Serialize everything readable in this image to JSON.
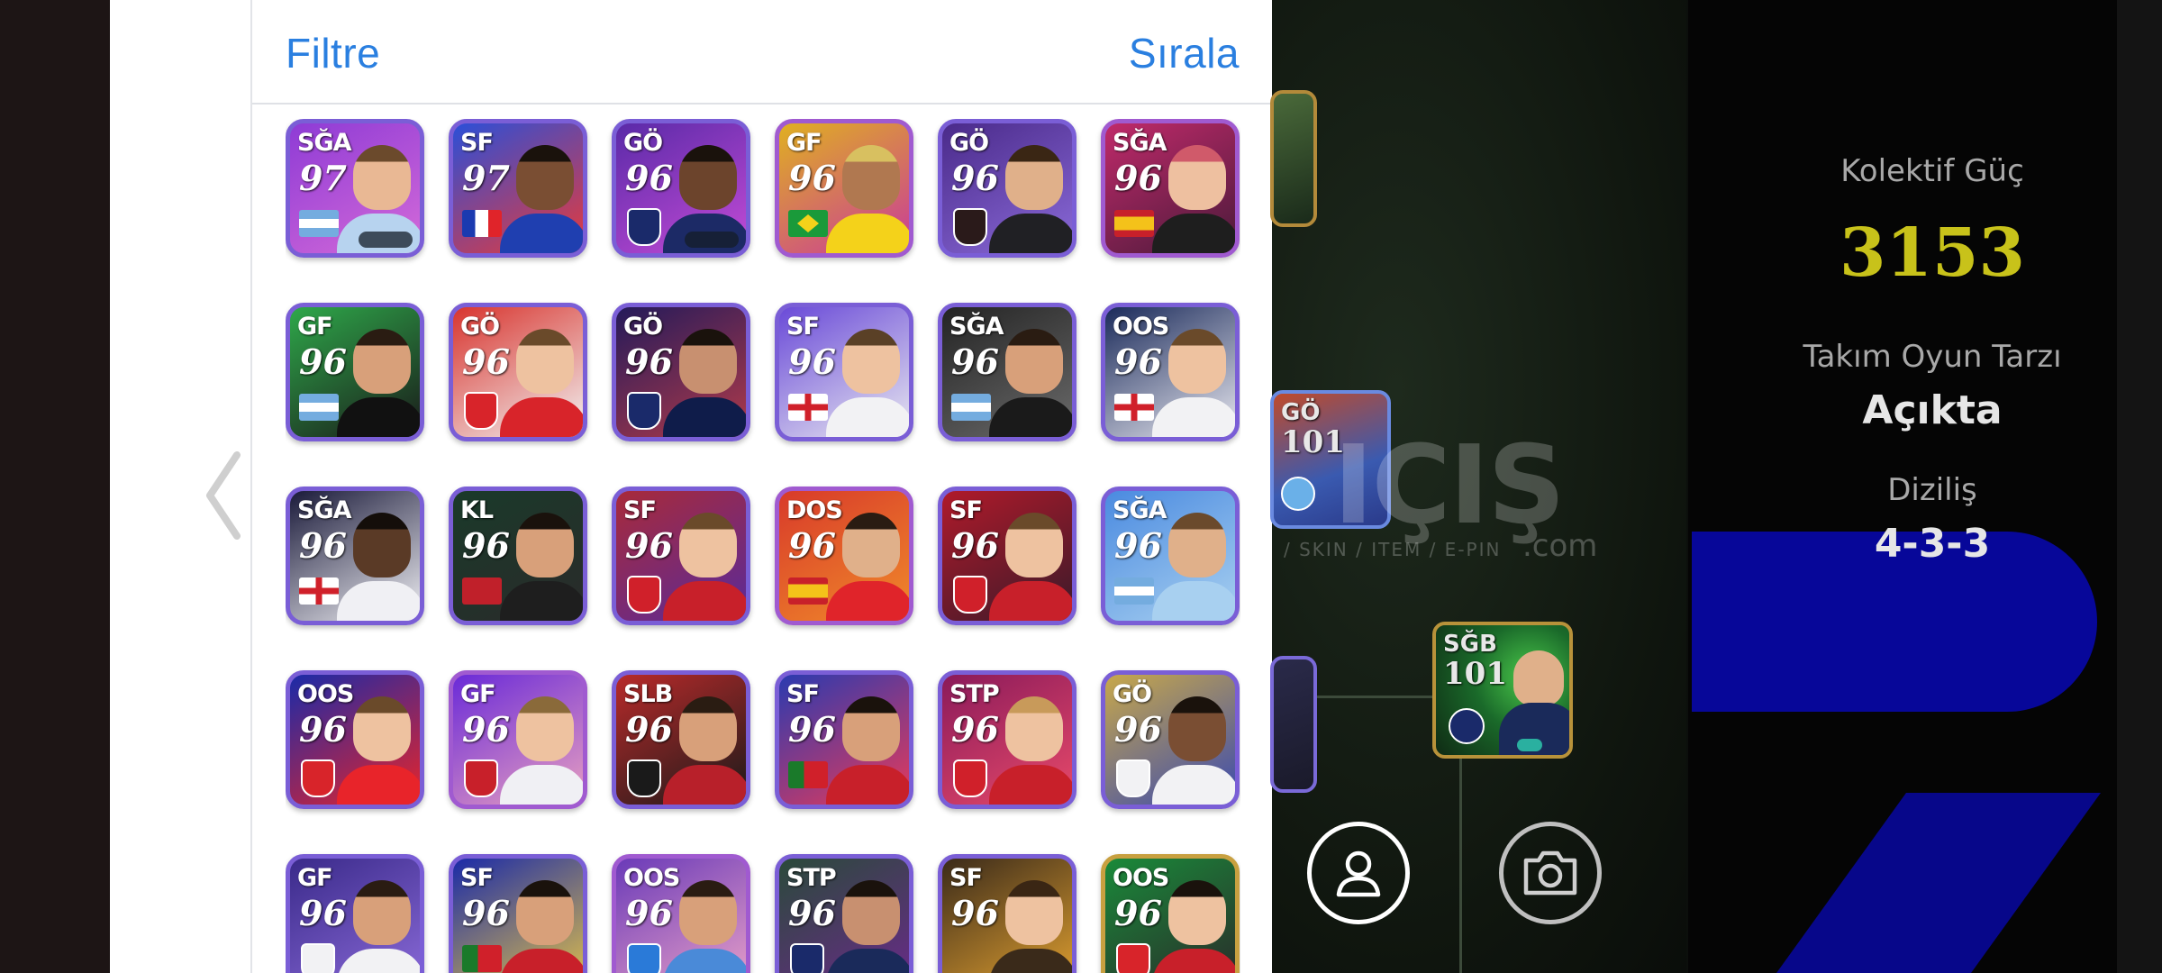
{
  "header": {
    "filter_label": "Filtre",
    "sort_label": "Sırala"
  },
  "players": [
    {
      "pos": "SĞA",
      "rating": "97",
      "bg": "#8e3bd6",
      "bg2": "#d46ad8",
      "frame": "#7a5ed6",
      "skin": "#e9b894",
      "hair": "#6b4a2c",
      "kit": "#b7d3ef",
      "mark": "flag-argentina"
    },
    {
      "pos": "SF",
      "rating": "97",
      "bg": "#2b4fd8",
      "bg2": "#e83a3a",
      "frame": "#7a5ed6",
      "skin": "#7a4e33",
      "hair": "#1a120c",
      "kit": "#1f3fb0",
      "mark": "flag-france"
    },
    {
      "pos": "GÖ",
      "rating": "96",
      "bg": "#5a2aa8",
      "bg2": "#c34bd6",
      "frame": "#7a5ed6",
      "skin": "#6c442c",
      "hair": "#1a120c",
      "kit": "#1c2a66",
      "mark": "badge-psg"
    },
    {
      "pos": "GF",
      "rating": "96",
      "bg": "#e0b020",
      "bg2": "#c93a9a",
      "frame": "#a05ad0",
      "skin": "#b07850",
      "hair": "#d8c060",
      "kit": "#f4d21a",
      "mark": "flag-brazil"
    },
    {
      "pos": "GÖ",
      "rating": "96",
      "bg": "#4a2a8a",
      "bg2": "#8a6ad8",
      "frame": "#7a5ed6",
      "skin": "#e0b08a",
      "hair": "#3a2614",
      "kit": "#202024",
      "mark": "badge-dark"
    },
    {
      "pos": "SĞA",
      "rating": "96",
      "bg": "#c02a6a",
      "bg2": "#4a1a3a",
      "frame": "#a05ad0",
      "skin": "#eec0a0",
      "hair": "#d05a6a",
      "kit": "#1e1e1e",
      "mark": "flag-spain"
    },
    {
      "pos": "GF",
      "rating": "96",
      "bg": "#2ea84a",
      "bg2": "#1a1a1a",
      "frame": "#7a5ed6",
      "skin": "#d8a07a",
      "hair": "#2a1c12",
      "kit": "#111111",
      "mark": "flag-argentina"
    },
    {
      "pos": "GÖ",
      "rating": "96",
      "bg": "#d8342e",
      "bg2": "#f2f2f2",
      "frame": "#7a5ed6",
      "skin": "#eec2a0",
      "hair": "#6a4a2a",
      "kit": "#d8242a",
      "mark": "badge-arsenal"
    },
    {
      "pos": "GÖ",
      "rating": "96",
      "bg": "#241a5a",
      "bg2": "#b03a4a",
      "frame": "#7a5ed6",
      "skin": "#c89070",
      "hair": "#1a120c",
      "kit": "#0f1c4a",
      "mark": "badge-psg"
    },
    {
      "pos": "SF",
      "rating": "96",
      "bg": "#6a4ad8",
      "bg2": "#e8e8f0",
      "frame": "#7a5ed6",
      "skin": "#eec2a0",
      "hair": "#5a4026",
      "kit": "#f2f2f4",
      "mark": "flag-england"
    },
    {
      "pos": "SĞA",
      "rating": "96",
      "bg": "#242424",
      "bg2": "#6a6a6a",
      "frame": "#7a5ed6",
      "skin": "#d8a07a",
      "hair": "#2a1c12",
      "kit": "#1a1a1a",
      "mark": "flag-argentina"
    },
    {
      "pos": "OOS",
      "rating": "96",
      "bg": "#1a2a5a",
      "bg2": "#e8e8f0",
      "frame": "#7a5ed6",
      "skin": "#eec2a0",
      "hair": "#6a4a2a",
      "kit": "#f2f2f4",
      "mark": "flag-england"
    },
    {
      "pos": "SĞA",
      "rating": "96",
      "bg": "#1a1a3a",
      "bg2": "#f0f0f4",
      "frame": "#7a5ed6",
      "skin": "#5a3a26",
      "hair": "#140e0a",
      "kit": "#f0f0f4",
      "mark": "flag-england"
    },
    {
      "pos": "KL",
      "rating": "96",
      "bg": "#1a3a2a",
      "bg2": "#2a2a2a",
      "frame": "#7a5ed6",
      "skin": "#d8a07a",
      "hair": "#1a120c",
      "kit": "#1e1e1e",
      "mark": "flag-morocco"
    },
    {
      "pos": "SF",
      "rating": "96",
      "bg": "#a82a3a",
      "bg2": "#5a2a9a",
      "frame": "#7a5ed6",
      "skin": "#eec2a0",
      "hair": "#6a4a2a",
      "kit": "#c8202a",
      "mark": "badge-bayern"
    },
    {
      "pos": "DOS",
      "rating": "96",
      "bg": "#d83a2a",
      "bg2": "#f08a2a",
      "frame": "#a05ad0",
      "skin": "#e0b08a",
      "hair": "#2a1c12",
      "kit": "#e0242a",
      "mark": "flag-spain"
    },
    {
      "pos": "SF",
      "rating": "96",
      "bg": "#b01a2a",
      "bg2": "#3a1a2a",
      "frame": "#7a5ed6",
      "skin": "#eec2a0",
      "hair": "#6a4a2a",
      "kit": "#c8202a",
      "mark": "badge-bayern"
    },
    {
      "pos": "SĞA",
      "rating": "96",
      "bg": "#4a8ae0",
      "bg2": "#a8d0f0",
      "frame": "#7a5ed6",
      "skin": "#e0b08a",
      "hair": "#6a4a2c",
      "kit": "#a8d0f0",
      "mark": "flag-argentina"
    },
    {
      "pos": "OOS",
      "rating": "96",
      "bg": "#1a2aa8",
      "bg2": "#e8242a",
      "frame": "#7a5ed6",
      "skin": "#eec2a0",
      "hair": "#6a4a2a",
      "kit": "#e8242a",
      "mark": "badge-arsenal"
    },
    {
      "pos": "GF",
      "rating": "96",
      "bg": "#6a2ad8",
      "bg2": "#e8a0c0",
      "frame": "#a05ad0",
      "skin": "#eec2a0",
      "hair": "#8a6a3a",
      "kit": "#f0f0f4",
      "mark": "badge-atletico"
    },
    {
      "pos": "SLB",
      "rating": "96",
      "bg": "#b82a2a",
      "bg2": "#1a1a1a",
      "frame": "#7a5ed6",
      "skin": "#d8a07a",
      "hair": "#2a1c12",
      "kit": "#b8202a",
      "mark": "badge-milan"
    },
    {
      "pos": "SF",
      "rating": "96",
      "bg": "#2a3ab0",
      "bg2": "#e83a5a",
      "frame": "#7a5ed6",
      "skin": "#d8a07a",
      "hair": "#1a120c",
      "kit": "#c8202a",
      "mark": "flag-portugal"
    },
    {
      "pos": "STP",
      "rating": "96",
      "bg": "#8a1a5a",
      "bg2": "#e84a6a",
      "frame": "#7a5ed6",
      "skin": "#eec2a0",
      "hair": "#c89a5a",
      "kit": "#c8202a",
      "mark": "badge-bayern"
    },
    {
      "pos": "GÖ",
      "rating": "96",
      "bg": "#c8a84a",
      "bg2": "#3a4ab0",
      "frame": "#7a5ed6",
      "skin": "#7a4e33",
      "hair": "#1a120c",
      "kit": "#f2f2f4",
      "mark": "badge-realmadrid"
    },
    {
      "pos": "GF",
      "rating": "96",
      "bg": "#3a2a8a",
      "bg2": "#8a6ad8",
      "frame": "#7a5ed6",
      "skin": "#d8a07a",
      "hair": "#2a1c12",
      "kit": "#f2f2f4",
      "mark": "badge-botafogo"
    },
    {
      "pos": "SF",
      "rating": "96",
      "bg": "#1a2aa8",
      "bg2": "#e0c04a",
      "frame": "#7a5ed6",
      "skin": "#d8a07a",
      "hair": "#1a120c",
      "kit": "#c8202a",
      "mark": "flag-portugal"
    },
    {
      "pos": "OOS",
      "rating": "96",
      "bg": "#6a3ab8",
      "bg2": "#e8a0c8",
      "frame": "#a05ad0",
      "skin": "#d8a07a",
      "hair": "#2a1c12",
      "kit": "#4a8ad8",
      "mark": "badge-napoli"
    },
    {
      "pos": "STP",
      "rating": "96",
      "bg": "#2a4a3a",
      "bg2": "#6a2a8a",
      "frame": "#7a5ed6",
      "skin": "#c89070",
      "hair": "#1a120c",
      "kit": "#1a2a5a",
      "mark": "badge-psg"
    },
    {
      "pos": "SF",
      "rating": "96",
      "bg": "#3a2a1a",
      "bg2": "#e0a030",
      "frame": "#7a5ed6",
      "skin": "#eec2a0",
      "hair": "#3a2614",
      "kit": "#3a2a1a",
      "mark": "flag-none"
    },
    {
      "pos": "OOS",
      "rating": "96",
      "bg": "#1a8a3a",
      "bg2": "#2a2a2a",
      "frame": "#c8a040",
      "skin": "#eec2a0",
      "hair": "#1a120c",
      "kit": "#c8202a",
      "mark": "badge-arsenal"
    }
  ],
  "pitch_cards": [
    {
      "pos": "GÖ",
      "rating": "101",
      "mark": "badge-mancity"
    },
    {
      "pos": "SĞB",
      "rating": "101",
      "mark": "badge-inter"
    }
  ],
  "watermark": {
    "text": "IÇIŞ",
    "sub": "/ SKIN / ITEM / E-PIN",
    "com": ".com"
  },
  "stats": {
    "strength_label": "Kolektif Güç",
    "strength_value": "3153",
    "playstyle_label": "Takım Oyun Tarzı",
    "playstyle_value": "Açıkta",
    "formation_label": "Diziliş",
    "formation_value": "4-3-3"
  },
  "colors": {
    "accent": "#2a7fe0",
    "strength": "#c8c21a"
  }
}
